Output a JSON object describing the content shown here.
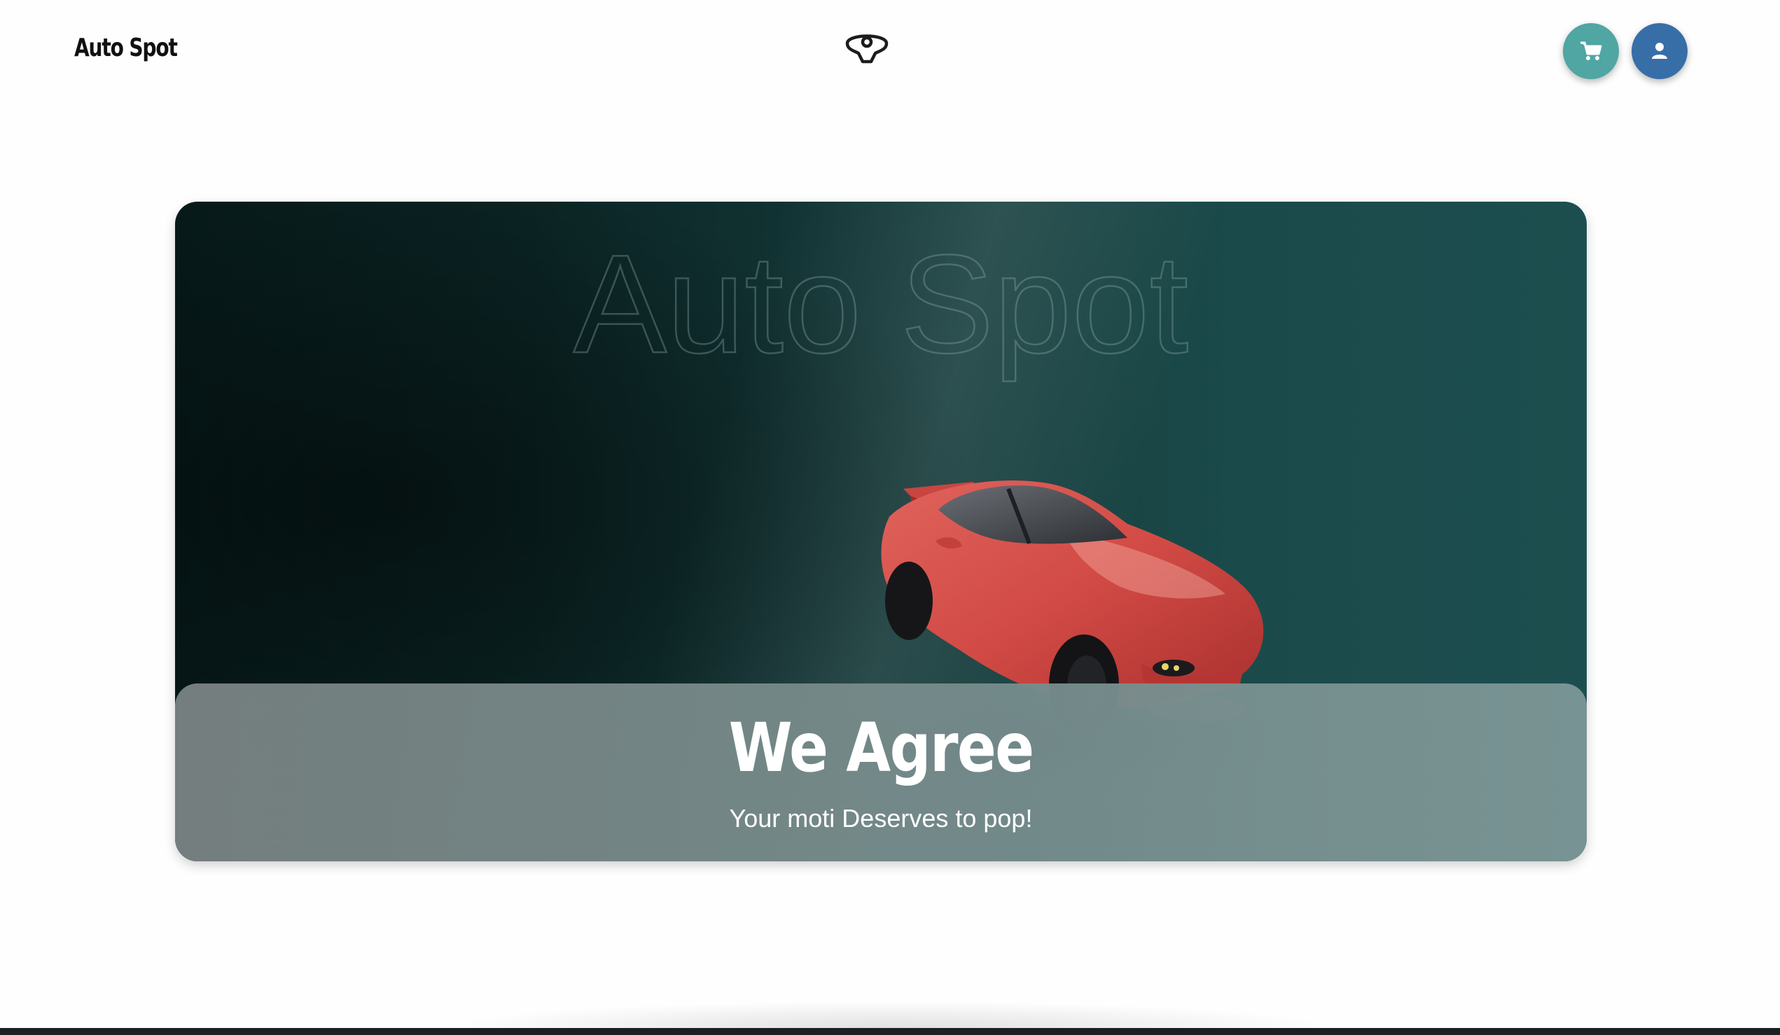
{
  "header": {
    "brand": "Auto Spot",
    "logo_icon": "steering-wheel-icon",
    "cart_icon": "cart-icon",
    "user_icon": "user-icon",
    "cart_color": "#4fa6a3",
    "user_color": "#386ea8"
  },
  "hero": {
    "background_text": "Auto Spot",
    "image": "red-sports-car",
    "caption_title": "We Agree",
    "caption_subtitle": "Your moti Deserves to pop!"
  }
}
